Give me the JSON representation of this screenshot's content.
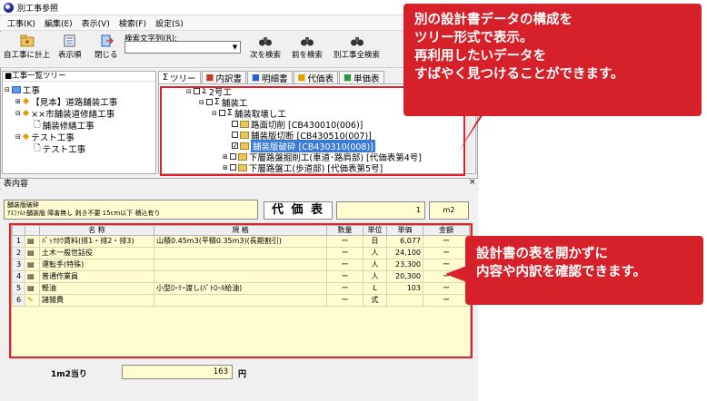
{
  "window": {
    "title": "別工事参照"
  },
  "menu": [
    "工事(K)",
    "編集(E)",
    "表示(V)",
    "検索(F)",
    "設定(S)"
  ],
  "toolbar": {
    "buttons": [
      {
        "label": "自工事に計上"
      },
      {
        "label": "表示順"
      },
      {
        "label": "閉じる"
      }
    ],
    "search_label": "検索文字列(R):",
    "search_value": "",
    "search_buttons": [
      {
        "label": "次を検索"
      },
      {
        "label": "前を検索"
      },
      {
        "label": "別工事全検索"
      }
    ]
  },
  "left_pane": {
    "header": "■工事一覧ツリー",
    "items": [
      {
        "label": "工事"
      },
      {
        "label": "【見本】道路舗装工事"
      },
      {
        "label": "××市舗装道修繕工事"
      },
      {
        "label": "舗装修繕工事"
      },
      {
        "label": "テスト工事"
      },
      {
        "label": "テスト工事"
      }
    ]
  },
  "tabs": [
    {
      "label": "ツリー"
    },
    {
      "label": "内訳書"
    },
    {
      "label": "明細書"
    },
    {
      "label": "代価表"
    },
    {
      "label": "単価表"
    }
  ],
  "tree": [
    {
      "label": "2号工"
    },
    {
      "label": "舗装工"
    },
    {
      "label": "舗装取壊し工"
    },
    {
      "label": "路面切削 [CB430010(006)]"
    },
    {
      "label": "舗装版切断 [CB430510(007)]"
    },
    {
      "label": "舗装版破砕 [CB430310(008)]"
    },
    {
      "label": "下層路盤掘削工(車道･路肩部) [代価表第4号]"
    },
    {
      "label": "下層路盤工(歩道部) [代価表第5号]"
    }
  ],
  "lower": {
    "header": "表内容",
    "info_line1": "舗装版破砕",
    "info_line2": "ｱｽﾌｧﾙﾄ舗装版 障害無し 剥き不要 15cm以下 積込有り",
    "daika_label": "代 価 表",
    "qty": "1",
    "unit": "m2",
    "columns": [
      "名 称",
      "規 格",
      "数量",
      "単位",
      "単価",
      "金額"
    ],
    "rows": [
      {
        "no": "1",
        "name": "ﾊﾞｯｸﾎｳ賃料(排1・排2・排3)",
        "spec": "山積0.45m3(平積0.35m3)(長期割引)",
        "qty": "ー",
        "unit": "日",
        "price": "6,077",
        "amount": "ー"
      },
      {
        "no": "2",
        "name": "土木一般世話役",
        "spec": "",
        "qty": "ー",
        "unit": "人",
        "price": "24,100",
        "amount": "ー"
      },
      {
        "no": "3",
        "name": "運転手(特殊)",
        "spec": "",
        "qty": "ー",
        "unit": "人",
        "price": "23,300",
        "amount": "ー"
      },
      {
        "no": "4",
        "name": "普通作業員",
        "spec": "",
        "qty": "ー",
        "unit": "人",
        "price": "20,300",
        "amount": "ー"
      },
      {
        "no": "5",
        "name": "軽油",
        "spec": "小型ﾛｰﾘｰ渡し(ﾊﾟﾄﾛｰﾙ給油)",
        "qty": "ー",
        "unit": "L",
        "price": "103",
        "amount": "ー"
      },
      {
        "no": "6",
        "name": "諸雑費",
        "spec": "",
        "qty": "ー",
        "unit": "式",
        "price": "",
        "amount": "ー"
      }
    ],
    "per_label": "1m2当り",
    "per_value": "163",
    "per_unit": "円"
  },
  "callouts": {
    "top_lines": [
      "別の設計書データの構成を",
      "ツリー形式で表示。",
      "再利用したいデータを",
      "すばやく見つけることができます。"
    ],
    "bottom_lines": [
      "設計書の表を開かずに",
      "内容や内訳を確認できます。"
    ]
  },
  "colors": {
    "accent": "#d7212a",
    "highlight_row": "#3b7bd6",
    "cell_bg": "#fffdd0"
  }
}
